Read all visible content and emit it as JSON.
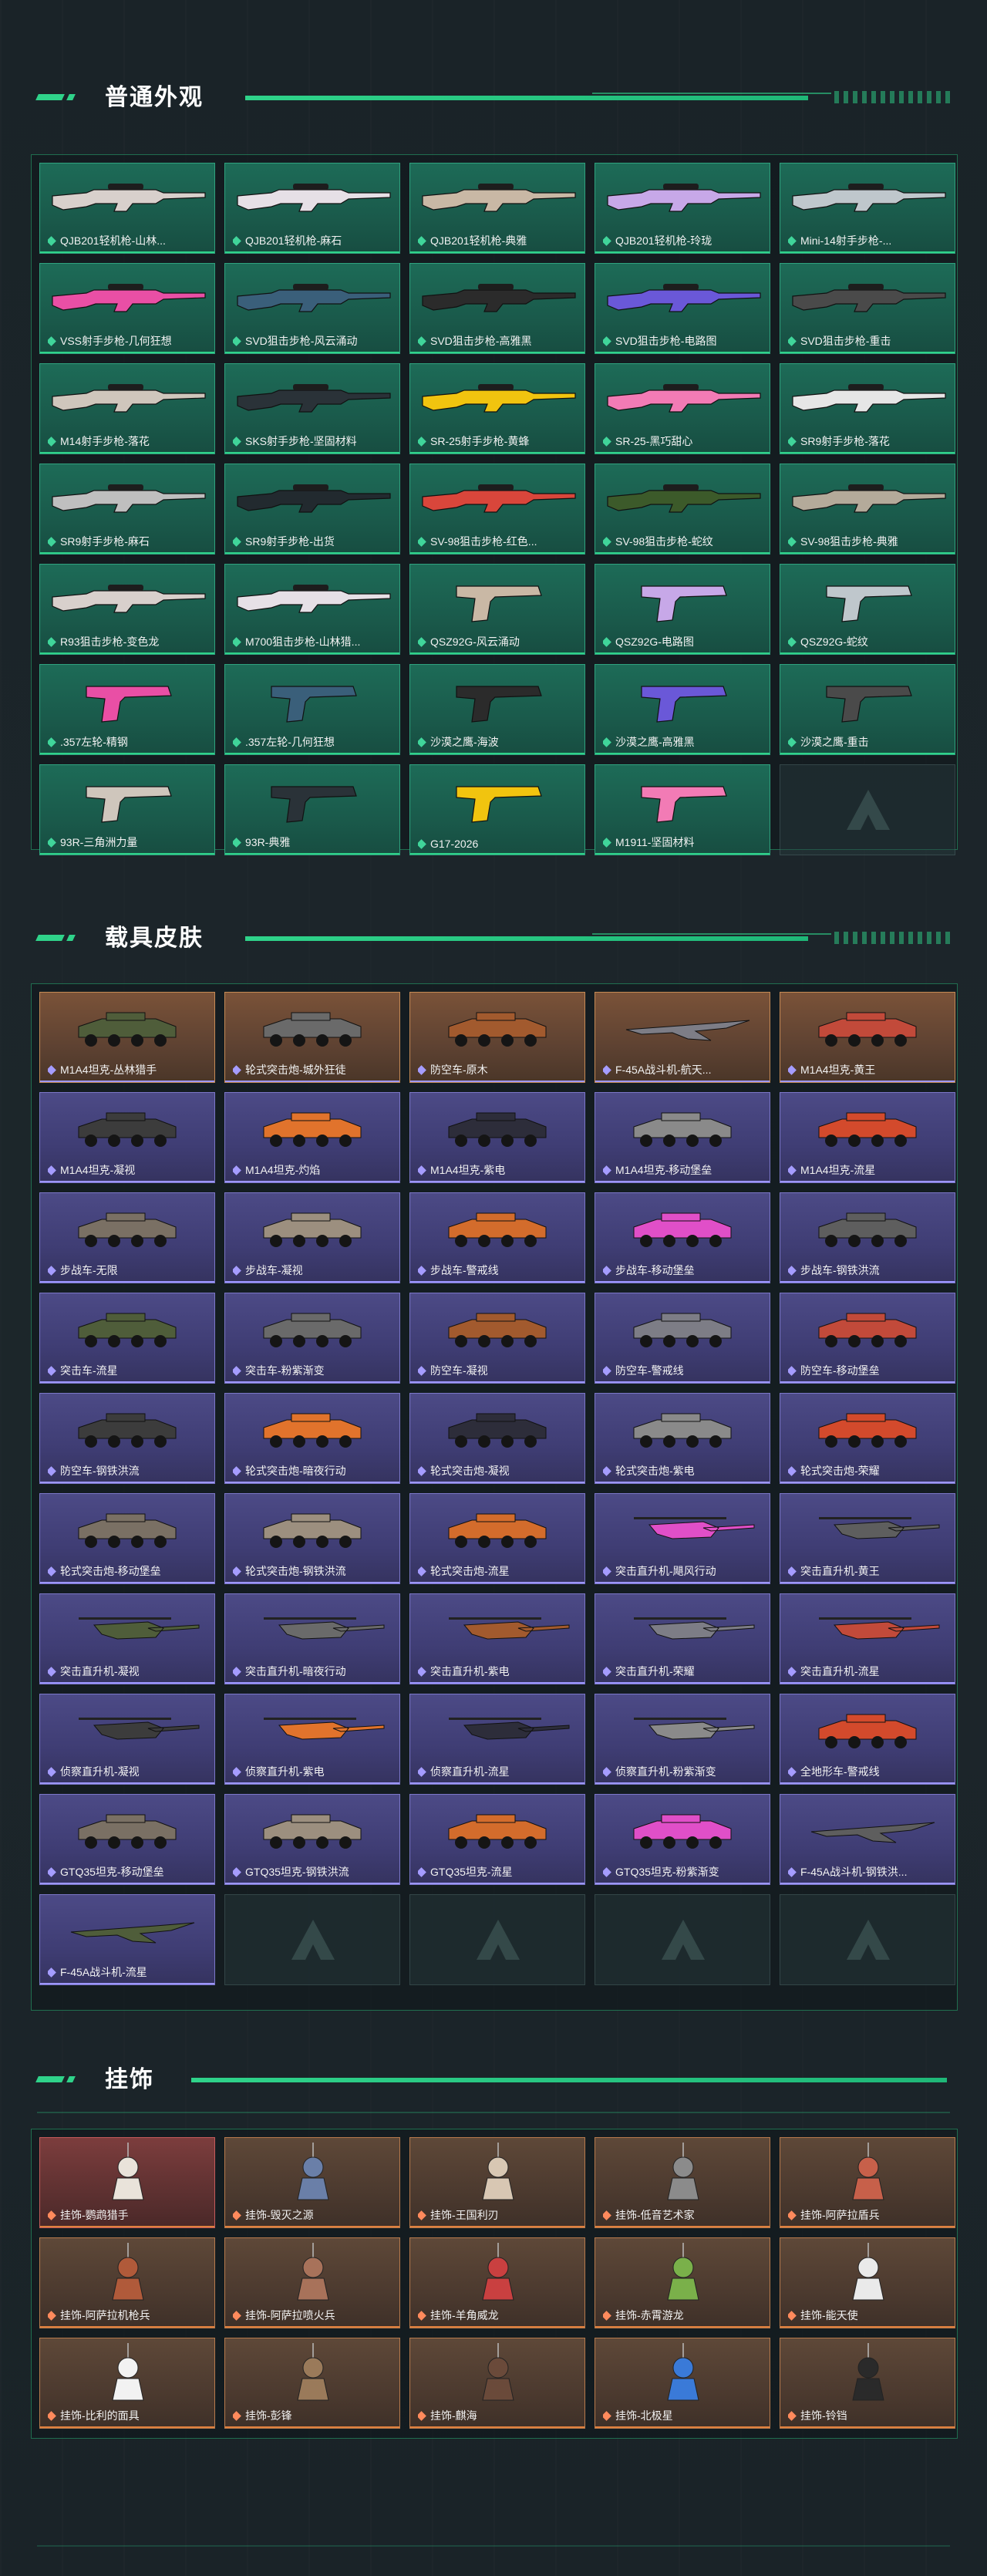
{
  "sections": {
    "weapons": {
      "title": "普通外观",
      "items": [
        "QJB201轻机枪-山林...",
        "QJB201轻机枪-麻石",
        "QJB201轻机枪-典雅",
        "QJB201轻机枪-玲珑",
        "Mini-14射手步枪-...",
        "VSS射手步枪-几何狂想",
        "SVD狙击步枪-风云涌动",
        "SVD狙击步枪-高雅黑",
        "SVD狙击步枪-电路图",
        "SVD狙击步枪-重击",
        "M14射手步枪-落花",
        "SKS射手步枪-坚固材料",
        "SR-25射手步枪-黄蜂",
        "SR-25-黑巧甜心",
        "SR9射手步枪-落花",
        "SR9射手步枪-麻石",
        "SR9射手步枪-出货",
        "SV-98狙击步枪-红色...",
        "SV-98狙击步枪-蛇纹",
        "SV-98狙击步枪-典雅",
        "R93狙击步枪-变色龙",
        "M700狙击步枪-山林猎...",
        "QSZ92G-风云涌动",
        "QSZ92G-电路图",
        "QSZ92G-蛇纹",
        ".357左轮-精钢",
        ".357左轮-几何狂想",
        "沙漠之鹰-海波",
        "沙漠之鹰-高雅黑",
        "沙漠之鹰-重击",
        "93R-三角洲力量",
        "93R-典雅",
        "G17-2026",
        "M1911-坚固材料",
        ""
      ]
    },
    "vehicles": {
      "title": "载具皮肤",
      "items": [
        "M1A4坦克-丛林猎手",
        "轮式突击炮-城外狂徒",
        "防空车-原木",
        "F-45A战斗机-航天...",
        "M1A4坦克-黄王",
        "M1A4坦克-凝视",
        "M1A4坦克-灼焰",
        "M1A4坦克-紫电",
        "M1A4坦克-移动堡垒",
        "M1A4坦克-流星",
        "步战车-无限",
        "步战车-凝视",
        "步战车-警戒线",
        "步战车-移动堡垒",
        "步战车-钢铁洪流",
        "突击车-流星",
        "突击车-粉紫渐变",
        "防空车-凝视",
        "防空车-警戒线",
        "防空车-移动堡垒",
        "防空车-钢铁洪流",
        "轮式突击炮-暗夜行动",
        "轮式突击炮-凝视",
        "轮式突击炮-紫电",
        "轮式突击炮-荣耀",
        "轮式突击炮-移动堡垒",
        "轮式突击炮-钢铁洪流",
        "轮式突击炮-流星",
        "突击直升机-飓风行动",
        "突击直升机-黄王",
        "突击直升机-凝视",
        "突击直升机-暗夜行动",
        "突击直升机-紫电",
        "突击直升机-荣耀",
        "突击直升机-流星",
        "侦察直升机-凝视",
        "侦察直升机-紫电",
        "侦察直升机-流星",
        "侦察直升机-粉紫渐变",
        "全地形车-警戒线",
        "GTQ35坦克-移动堡垒",
        "GTQ35坦克-钢铁洪流",
        "GTQ35坦克-流星",
        "GTQ35坦克-粉紫渐变",
        "F-45A战斗机-钢铁洪...",
        "F-45A战斗机-流星",
        "",
        "",
        "",
        ""
      ]
    },
    "accessories": {
      "title": "挂饰",
      "items": [
        "挂饰-鹦鹉猎手",
        "挂饰-毁灭之源",
        "挂饰-王国利刃",
        "挂饰-低音艺术家",
        "挂饰-阿萨拉盾兵",
        "挂饰-阿萨拉机枪兵",
        "挂饰-阿萨拉喷火兵",
        "挂饰-羊角威龙",
        "挂饰-赤霄游龙",
        "挂饰-能天使",
        "挂饰-比利的面具",
        "挂饰-彭锋",
        "挂饰-麒海",
        "挂饰-北极星",
        "挂饰-铃铛"
      ]
    }
  },
  "colors": {
    "accent": "#2fd38a",
    "weapon_bg": "#1d6b57",
    "vehicle_bg": "#4c4a86",
    "accessory_bg": "#5e4838"
  }
}
